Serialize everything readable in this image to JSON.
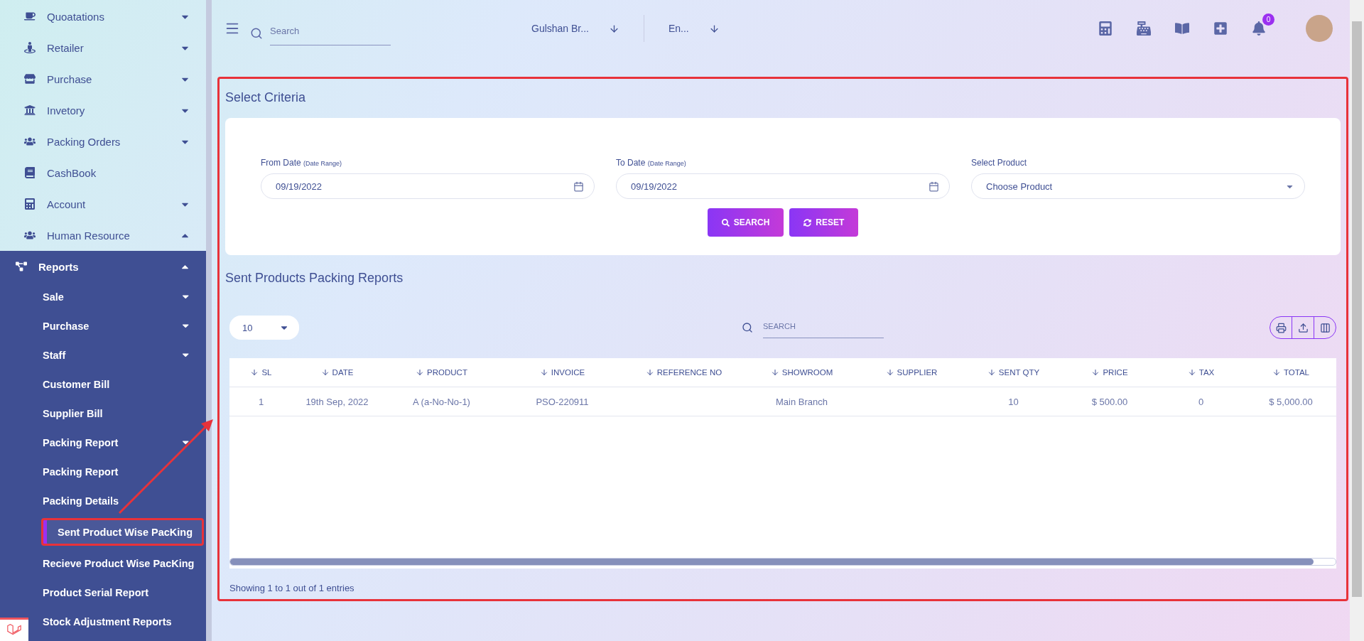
{
  "sidebar": {
    "items": [
      {
        "label": "Quoatations",
        "kind": "dropdown",
        "expanded": false
      },
      {
        "label": "Retailer",
        "kind": "dropdown",
        "expanded": false
      },
      {
        "label": "Purchase",
        "kind": "dropdown",
        "expanded": false
      },
      {
        "label": "Invetory",
        "kind": "dropdown",
        "expanded": false
      },
      {
        "label": "Packing Orders",
        "kind": "dropdown",
        "expanded": false
      },
      {
        "label": "CashBook",
        "kind": "link"
      },
      {
        "label": "Account",
        "kind": "dropdown",
        "expanded": false
      },
      {
        "label": "Human Resource",
        "kind": "dropdown",
        "expanded": true
      }
    ],
    "reports": {
      "label": "Reports",
      "expanded": true,
      "children": [
        {
          "label": "Sale",
          "kind": "dropdown",
          "expanded": false,
          "selected": false
        },
        {
          "label": "Purchase",
          "kind": "dropdown",
          "expanded": false,
          "selected": false
        },
        {
          "label": "Staff",
          "kind": "dropdown",
          "expanded": false,
          "selected": false
        },
        {
          "label": "Customer Bill",
          "kind": "link",
          "selected": false
        },
        {
          "label": "Supplier Bill",
          "kind": "link",
          "selected": false
        },
        {
          "label": "Packing Report",
          "kind": "dropdown",
          "expanded": false,
          "selected": false
        },
        {
          "label": "Packing Report",
          "kind": "link",
          "selected": false
        },
        {
          "label": "Packing Details",
          "kind": "link",
          "selected": false
        },
        {
          "label": "Sent Product Wise PacKing",
          "kind": "link",
          "selected": true
        },
        {
          "label": "Recieve Product Wise PacKing",
          "kind": "link",
          "selected": false
        },
        {
          "label": "Product Serial Report",
          "kind": "link",
          "selected": false
        },
        {
          "label": "Stock Adjustment Reports",
          "kind": "link",
          "selected": false
        }
      ]
    }
  },
  "topbar": {
    "search": {
      "placeholder": "Search"
    },
    "branch": "Gulshan Br...",
    "language": "En...",
    "notifications": "0"
  },
  "criteria": {
    "title": "Select Criteria",
    "fields": [
      {
        "kind": "date",
        "label": "From Date",
        "hint": "(Date Range)",
        "value": "09/19/2022"
      },
      {
        "kind": "date",
        "label": "To Date",
        "hint": "(Date Range)",
        "value": "09/19/2022"
      },
      {
        "kind": "select",
        "label": "Select Product",
        "value": "Choose Product"
      }
    ],
    "buttons": [
      {
        "kind": "search",
        "label": "SEARCH"
      },
      {
        "kind": "reset",
        "label": "RESET"
      }
    ]
  },
  "report": {
    "title": "Sent Products Packing Reports",
    "page_size": "10",
    "search": {
      "placeholder": "SEARCH"
    },
    "columns": [
      "SL",
      "DATE",
      "PRODUCT",
      "INVOICE",
      "REFERENCE NO",
      "SHOWROOM",
      "SUPPLIER",
      "SENT QTY",
      "PRICE",
      "TAX",
      "TOTAL"
    ],
    "rows": [
      [
        "1",
        "19th Sep, 2022",
        "A (a-No-No-1)",
        "PSO-220911",
        "",
        "Main Branch",
        "",
        "10",
        "$ 500.00",
        "0",
        "$ 5,000.00"
      ]
    ],
    "footer": "Showing 1 to 1 out of 1 entries"
  }
}
